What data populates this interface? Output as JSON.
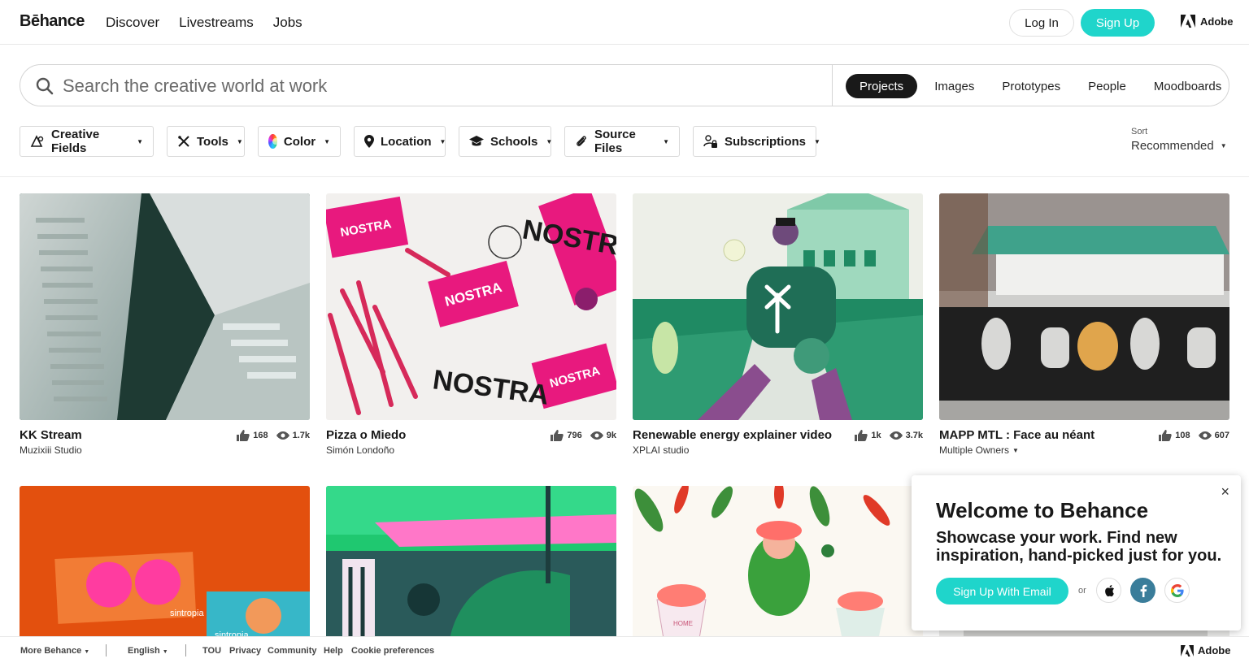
{
  "header": {
    "logo": "Bēhance",
    "nav": [
      "Discover",
      "Livestreams",
      "Jobs"
    ],
    "login": "Log In",
    "signup": "Sign Up",
    "adobe": "Adobe"
  },
  "search": {
    "placeholder": "Search the creative world at work",
    "tabs": [
      "Projects",
      "Images",
      "Prototypes",
      "People",
      "Moodboards"
    ],
    "active_tab": "Projects"
  },
  "filters": [
    {
      "label": "Creative Fields",
      "icon": "creative-fields-icon"
    },
    {
      "label": "Tools",
      "icon": "tools-icon"
    },
    {
      "label": "Color",
      "icon": "color-wheel-icon"
    },
    {
      "label": "Location",
      "icon": "location-pin-icon"
    },
    {
      "label": "Schools",
      "icon": "graduation-cap-icon"
    },
    {
      "label": "Source Files",
      "icon": "paperclip-icon"
    },
    {
      "label": "Subscriptions",
      "icon": "user-lock-icon"
    }
  ],
  "sort": {
    "label": "Sort",
    "value": "Recommended"
  },
  "projects": [
    {
      "title": "KK Stream",
      "owner": "Muzixiii Studio",
      "likes": "168",
      "views": "1.7k"
    },
    {
      "title": "Pizza o Miedo",
      "owner": "Simón Londoño",
      "likes": "796",
      "views": "9k"
    },
    {
      "title": "Renewable energy explainer video",
      "owner": "XPLAI studio",
      "likes": "1k",
      "views": "3.7k"
    },
    {
      "title": "MAPP MTL : Face au néant",
      "owner": "Multiple Owners",
      "likes": "108",
      "views": "607"
    }
  ],
  "thumb_text": {
    "nostra": "NOSTRA",
    "sintropia": "sintropia",
    "home": "HOME"
  },
  "popup": {
    "title": "Welcome to Behance",
    "subtitle": "Showcase your work. Find new inspiration, hand-picked just for you.",
    "signup_email": "Sign Up With Email",
    "or": "or",
    "close": "×"
  },
  "footer": {
    "more": "More Behance",
    "language": "English",
    "links": [
      "TOU",
      "Privacy",
      "Community",
      "Help",
      "Cookie preferences"
    ],
    "adobe": "Adobe"
  },
  "colors": {
    "accent": "#1fd5cb",
    "dark": "#191919"
  }
}
